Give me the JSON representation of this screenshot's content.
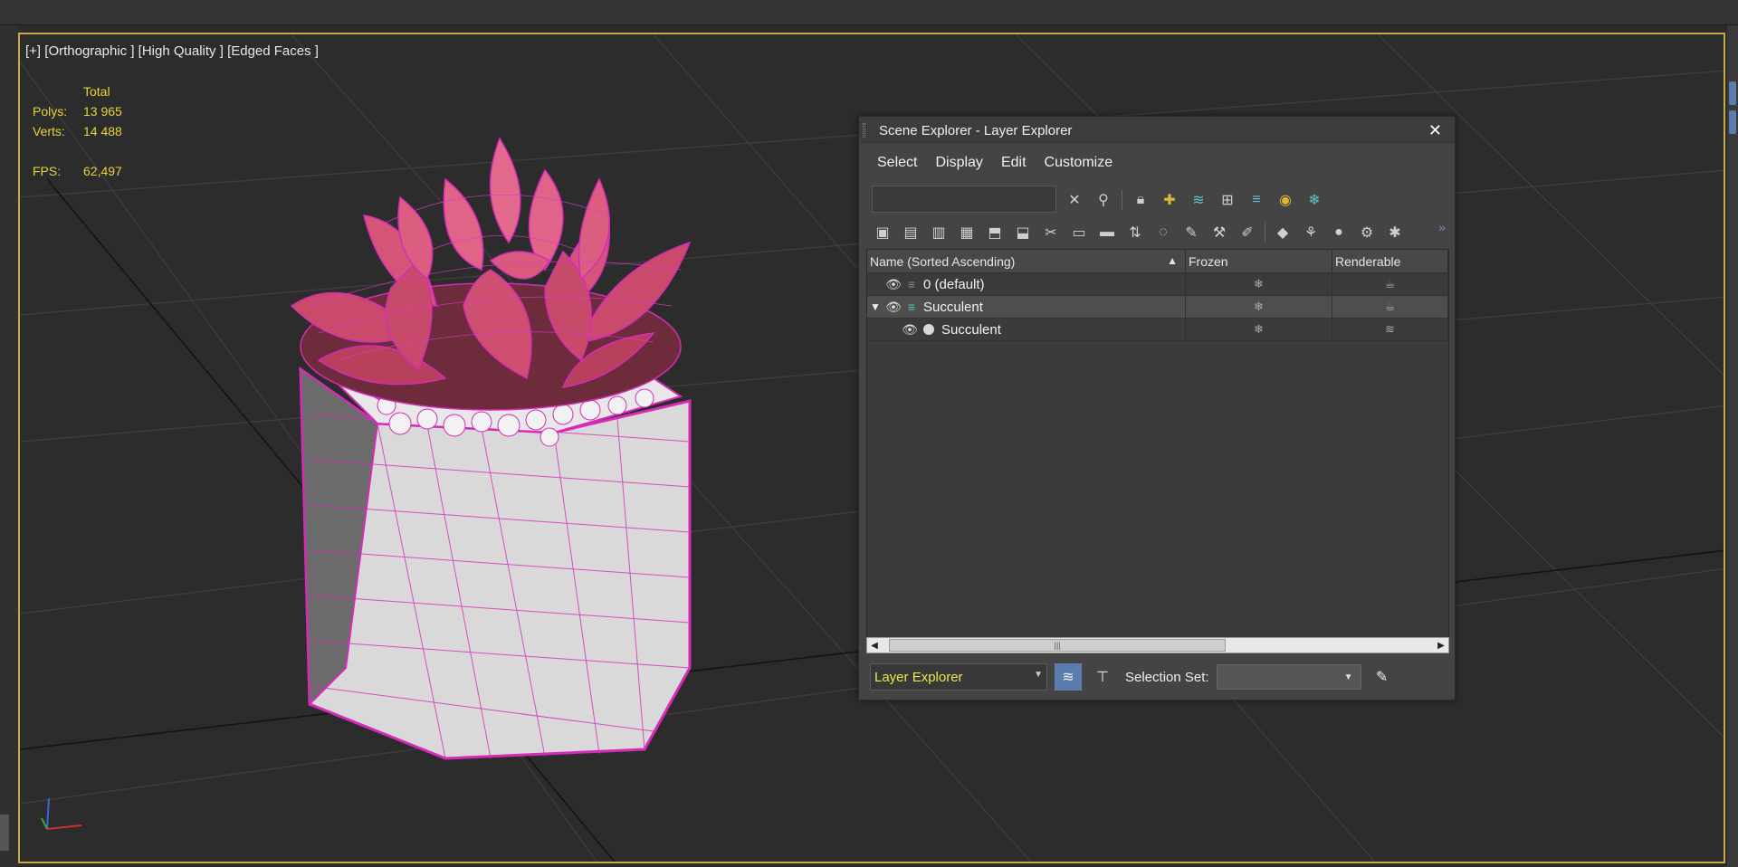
{
  "viewport": {
    "label_plus": "[+]",
    "label_view": "[Orthographic ]",
    "label_quality": "[High Quality ]",
    "label_shading": "[Edged Faces ]",
    "stats": {
      "total_label": "Total",
      "polys_label": "Polys:",
      "polys_value": "13 965",
      "verts_label": "Verts:",
      "verts_value": "14 488",
      "fps_label": "FPS:",
      "fps_value": "62,497"
    },
    "colors": {
      "border": "#c9a847",
      "stats": "#e8d23a",
      "wire": "#d62bb8"
    }
  },
  "panel": {
    "title": "Scene Explorer - Layer Explorer",
    "menu": [
      "Select",
      "Display",
      "Edit",
      "Customize"
    ],
    "search_value": "",
    "columns": {
      "name": "Name (Sorted Ascending)",
      "frozen": "Frozen",
      "renderable": "Renderable"
    },
    "rows": [
      {
        "name": "0 (default)"
      },
      {
        "name": "Succulent"
      },
      {
        "name": "Succulent"
      }
    ],
    "bottom": {
      "explorer_name": "Layer Explorer",
      "selection_set_label": "Selection Set:",
      "selection_set_value": ""
    }
  }
}
